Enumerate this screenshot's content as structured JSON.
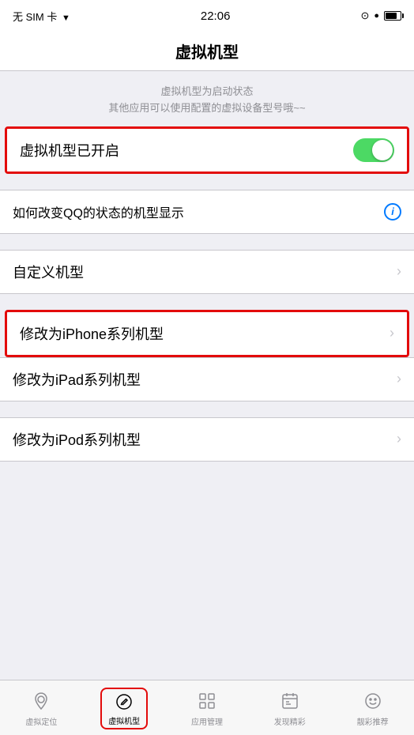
{
  "statusBar": {
    "simLabel": "无 SIM 卡",
    "signal": "▼",
    "time": "22:06",
    "icons": "© ● ",
    "battery": 80
  },
  "navBar": {
    "title": "虚拟机型"
  },
  "description": {
    "line1": "虚拟机型为启动状态",
    "line2": "其他应用可以使用配置的虚拟设备型号哦~~"
  },
  "toggleRow": {
    "label": "虚拟机型已开启",
    "enabled": true
  },
  "qqRow": {
    "label": "如何改变QQ的状态的机型显示"
  },
  "customRow": {
    "label": "自定义机型"
  },
  "iphoneRow": {
    "label": "修改为iPhone系列机型"
  },
  "ipadRow": {
    "label": "修改为iPad系列机型"
  },
  "ipodRow": {
    "label": "修改为iPod系列机型"
  },
  "tabBar": {
    "items": [
      {
        "id": "location",
        "label": "虚拟定位",
        "icon": "📍"
      },
      {
        "id": "virtual",
        "label": "虚拟机型",
        "icon": "✏",
        "active": true
      },
      {
        "id": "apps",
        "label": "应用管理",
        "icon": "⊞"
      },
      {
        "id": "discover",
        "label": "发现精彩",
        "icon": "📅"
      },
      {
        "id": "recommend",
        "label": "靓彩推荐",
        "icon": "😊"
      }
    ]
  }
}
